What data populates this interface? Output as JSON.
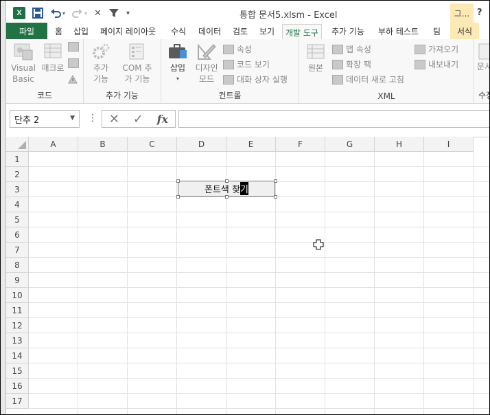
{
  "window": {
    "title": "통합 문서5.xlsm - Excel",
    "user_label": "그...",
    "help_label": "?"
  },
  "qat": {
    "app_icon": "X",
    "save_icon": "save-icon",
    "undo_icon": "undo-icon",
    "redo_icon": "redo-icon",
    "clear_icon": "✕",
    "filter_icon": "filter-icon",
    "more_icon": "▾"
  },
  "tabs": [
    {
      "label": "파일"
    },
    {
      "label": "홈"
    },
    {
      "label": "삽입"
    },
    {
      "label": "페이지 레이아웃"
    },
    {
      "label": "수식"
    },
    {
      "label": "데이터"
    },
    {
      "label": "검토"
    },
    {
      "label": "보기"
    },
    {
      "label": "개발 도구"
    },
    {
      "label": "추가 기능"
    },
    {
      "label": "부하 테스트"
    },
    {
      "label": "팀"
    },
    {
      "label": "서식"
    }
  ],
  "ribbon": {
    "code": {
      "label": "코드",
      "visual_basic": "Visual Basic",
      "macro": "매크로"
    },
    "addins": {
      "label": "추가 기능",
      "addin": "추가 기능",
      "com": "COM 추가 기능"
    },
    "controls": {
      "label": "컨트롤",
      "insert": "삽입",
      "design_mode": "디자인 모드",
      "properties": "속성",
      "view_code": "코드 보기",
      "run_dialog": "대화 상자 실행"
    },
    "xml": {
      "label": "XML",
      "source": "원본",
      "map_properties": "맵 속성",
      "expansion_packs": "확장 팩",
      "refresh_data": "데이터 새로 고침",
      "import": "가져오기",
      "export": "내보내기"
    },
    "modify": {
      "label": "수정",
      "document_panel": "문서"
    }
  },
  "formula_bar": {
    "name_box": "단추 2",
    "cancel": "✕",
    "enter": "✓",
    "fx": "fx",
    "value": ""
  },
  "grid": {
    "columns": [
      "A",
      "B",
      "C",
      "D",
      "E",
      "F",
      "G",
      "H",
      "I"
    ],
    "rows": [
      "1",
      "2",
      "3",
      "4",
      "5",
      "6",
      "7",
      "8",
      "9",
      "10",
      "11",
      "12",
      "13",
      "14",
      "15",
      "16",
      "17"
    ]
  },
  "form_button": {
    "text_before": "폰트색 찾",
    "text_selected": "기"
  }
}
